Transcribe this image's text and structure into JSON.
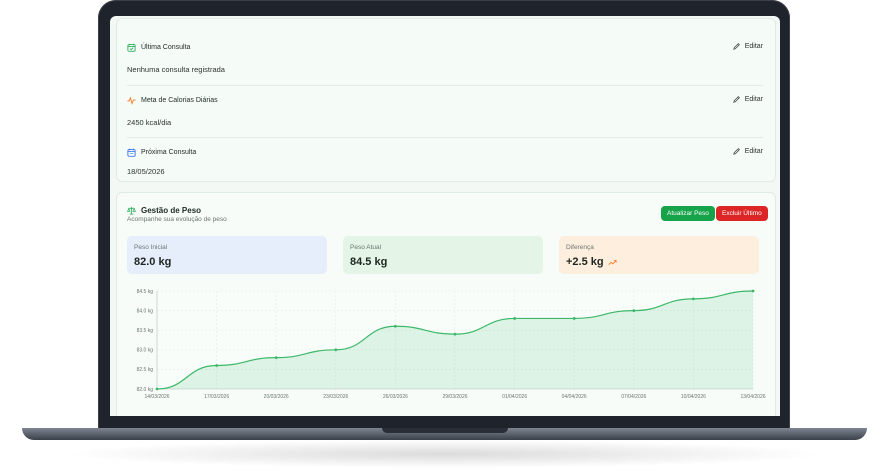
{
  "info": {
    "last_consult": {
      "title": "Última Consulta",
      "value": "Nenhuma consulta registrada",
      "edit": "Editar"
    },
    "calorie_goal": {
      "title": "Meta de Calorias Diárias",
      "value": "2450 kcal/dia",
      "edit": "Editar"
    },
    "next_consult": {
      "title": "Próxima Consulta",
      "value": "18/05/2026",
      "edit": "Editar"
    }
  },
  "weight": {
    "title": "Gestão de Peso",
    "subtitle": "Acompanhe sua evolução de peso",
    "update_label": "Atualizar Peso",
    "delete_label": "Excluir Último",
    "initial_label": "Peso Inicial",
    "initial_value": "82.0 kg",
    "current_label": "Peso Atual",
    "current_value": "84.5 kg",
    "diff_label": "Diferença",
    "diff_value": "+2.5 kg"
  },
  "colors": {
    "primary_green": "#16a34a",
    "danger_red": "#dc2626",
    "line_green": "#3cb868",
    "accent_orange": "#f97316",
    "calendar_blue": "#2563eb"
  },
  "chart_data": {
    "type": "area",
    "categories": [
      "14/03/2026",
      "17/03/2026",
      "20/03/2026",
      "23/03/2026",
      "26/03/2026",
      "29/03/2026",
      "01/04/2026",
      "04/04/2026",
      "07/04/2026",
      "10/04/2026",
      "13/04/2026"
    ],
    "values": [
      82.0,
      82.6,
      82.8,
      83.0,
      83.6,
      83.4,
      83.8,
      83.8,
      84.0,
      84.3,
      84.5
    ],
    "yticks": [
      "82.0 kg",
      "82.5 kg",
      "83.0 kg",
      "83.5 kg",
      "84.0 kg",
      "84.5 kg"
    ],
    "ylim": [
      82.0,
      84.5
    ],
    "grid": true
  }
}
